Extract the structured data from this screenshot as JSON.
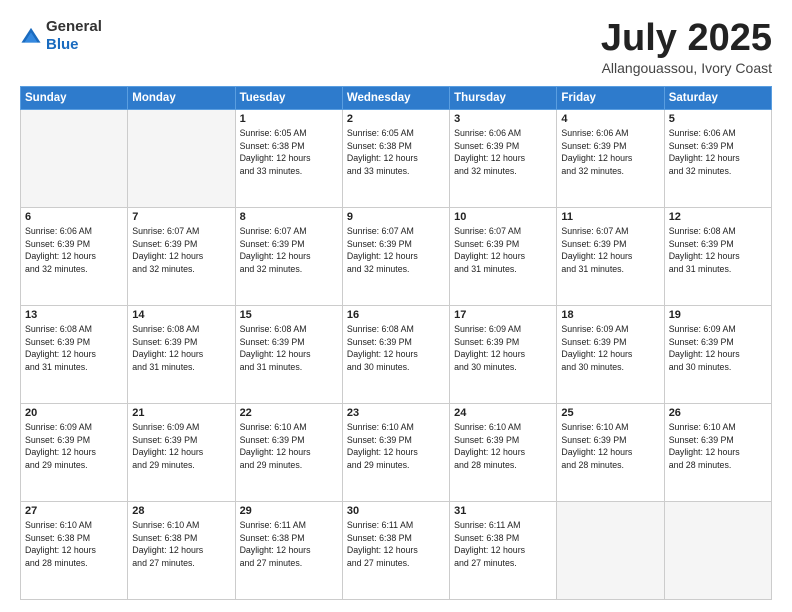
{
  "header": {
    "logo_general": "General",
    "logo_blue": "Blue",
    "month_title": "July 2025",
    "location": "Allangouassou, Ivory Coast"
  },
  "days_of_week": [
    "Sunday",
    "Monday",
    "Tuesday",
    "Wednesday",
    "Thursday",
    "Friday",
    "Saturday"
  ],
  "weeks": [
    [
      {
        "day": "",
        "info": ""
      },
      {
        "day": "",
        "info": ""
      },
      {
        "day": "1",
        "info": "Sunrise: 6:05 AM\nSunset: 6:38 PM\nDaylight: 12 hours\nand 33 minutes."
      },
      {
        "day": "2",
        "info": "Sunrise: 6:05 AM\nSunset: 6:38 PM\nDaylight: 12 hours\nand 33 minutes."
      },
      {
        "day": "3",
        "info": "Sunrise: 6:06 AM\nSunset: 6:39 PM\nDaylight: 12 hours\nand 32 minutes."
      },
      {
        "day": "4",
        "info": "Sunrise: 6:06 AM\nSunset: 6:39 PM\nDaylight: 12 hours\nand 32 minutes."
      },
      {
        "day": "5",
        "info": "Sunrise: 6:06 AM\nSunset: 6:39 PM\nDaylight: 12 hours\nand 32 minutes."
      }
    ],
    [
      {
        "day": "6",
        "info": "Sunrise: 6:06 AM\nSunset: 6:39 PM\nDaylight: 12 hours\nand 32 minutes."
      },
      {
        "day": "7",
        "info": "Sunrise: 6:07 AM\nSunset: 6:39 PM\nDaylight: 12 hours\nand 32 minutes."
      },
      {
        "day": "8",
        "info": "Sunrise: 6:07 AM\nSunset: 6:39 PM\nDaylight: 12 hours\nand 32 minutes."
      },
      {
        "day": "9",
        "info": "Sunrise: 6:07 AM\nSunset: 6:39 PM\nDaylight: 12 hours\nand 32 minutes."
      },
      {
        "day": "10",
        "info": "Sunrise: 6:07 AM\nSunset: 6:39 PM\nDaylight: 12 hours\nand 31 minutes."
      },
      {
        "day": "11",
        "info": "Sunrise: 6:07 AM\nSunset: 6:39 PM\nDaylight: 12 hours\nand 31 minutes."
      },
      {
        "day": "12",
        "info": "Sunrise: 6:08 AM\nSunset: 6:39 PM\nDaylight: 12 hours\nand 31 minutes."
      }
    ],
    [
      {
        "day": "13",
        "info": "Sunrise: 6:08 AM\nSunset: 6:39 PM\nDaylight: 12 hours\nand 31 minutes."
      },
      {
        "day": "14",
        "info": "Sunrise: 6:08 AM\nSunset: 6:39 PM\nDaylight: 12 hours\nand 31 minutes."
      },
      {
        "day": "15",
        "info": "Sunrise: 6:08 AM\nSunset: 6:39 PM\nDaylight: 12 hours\nand 31 minutes."
      },
      {
        "day": "16",
        "info": "Sunrise: 6:08 AM\nSunset: 6:39 PM\nDaylight: 12 hours\nand 30 minutes."
      },
      {
        "day": "17",
        "info": "Sunrise: 6:09 AM\nSunset: 6:39 PM\nDaylight: 12 hours\nand 30 minutes."
      },
      {
        "day": "18",
        "info": "Sunrise: 6:09 AM\nSunset: 6:39 PM\nDaylight: 12 hours\nand 30 minutes."
      },
      {
        "day": "19",
        "info": "Sunrise: 6:09 AM\nSunset: 6:39 PM\nDaylight: 12 hours\nand 30 minutes."
      }
    ],
    [
      {
        "day": "20",
        "info": "Sunrise: 6:09 AM\nSunset: 6:39 PM\nDaylight: 12 hours\nand 29 minutes."
      },
      {
        "day": "21",
        "info": "Sunrise: 6:09 AM\nSunset: 6:39 PM\nDaylight: 12 hours\nand 29 minutes."
      },
      {
        "day": "22",
        "info": "Sunrise: 6:10 AM\nSunset: 6:39 PM\nDaylight: 12 hours\nand 29 minutes."
      },
      {
        "day": "23",
        "info": "Sunrise: 6:10 AM\nSunset: 6:39 PM\nDaylight: 12 hours\nand 29 minutes."
      },
      {
        "day": "24",
        "info": "Sunrise: 6:10 AM\nSunset: 6:39 PM\nDaylight: 12 hours\nand 28 minutes."
      },
      {
        "day": "25",
        "info": "Sunrise: 6:10 AM\nSunset: 6:39 PM\nDaylight: 12 hours\nand 28 minutes."
      },
      {
        "day": "26",
        "info": "Sunrise: 6:10 AM\nSunset: 6:39 PM\nDaylight: 12 hours\nand 28 minutes."
      }
    ],
    [
      {
        "day": "27",
        "info": "Sunrise: 6:10 AM\nSunset: 6:38 PM\nDaylight: 12 hours\nand 28 minutes."
      },
      {
        "day": "28",
        "info": "Sunrise: 6:10 AM\nSunset: 6:38 PM\nDaylight: 12 hours\nand 27 minutes."
      },
      {
        "day": "29",
        "info": "Sunrise: 6:11 AM\nSunset: 6:38 PM\nDaylight: 12 hours\nand 27 minutes."
      },
      {
        "day": "30",
        "info": "Sunrise: 6:11 AM\nSunset: 6:38 PM\nDaylight: 12 hours\nand 27 minutes."
      },
      {
        "day": "31",
        "info": "Sunrise: 6:11 AM\nSunset: 6:38 PM\nDaylight: 12 hours\nand 27 minutes."
      },
      {
        "day": "",
        "info": ""
      },
      {
        "day": "",
        "info": ""
      }
    ]
  ]
}
